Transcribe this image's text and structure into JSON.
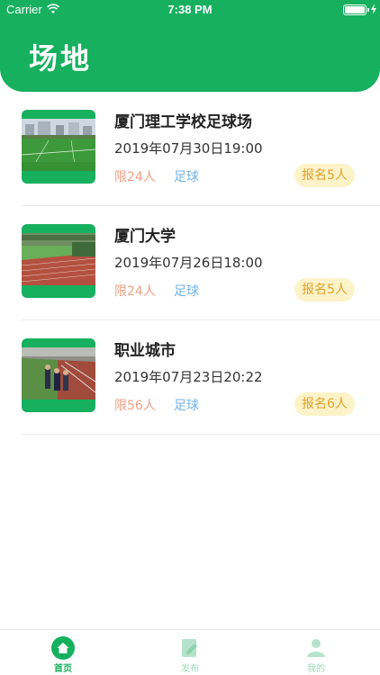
{
  "status_bar": {
    "carrier": "Carrier",
    "time": "7:38 PM"
  },
  "header": {
    "title": "场地"
  },
  "venues": [
    {
      "name": "厦门理工学校足球场",
      "datetime": "2019年07月30日19:00",
      "limit": "限24人",
      "sport": "足球",
      "signup": "报名5人"
    },
    {
      "name": "厦门大学",
      "datetime": "2019年07月26日18:00",
      "limit": "限24人",
      "sport": "足球",
      "signup": "报名5人"
    },
    {
      "name": "职业城市",
      "datetime": "2019年07月23日20:22",
      "limit": "限56人",
      "sport": "足球",
      "signup": "报名6人"
    }
  ],
  "tabs": [
    {
      "label": "首页",
      "icon": "home-icon",
      "active": true
    },
    {
      "label": "发布",
      "icon": "edit-icon",
      "active": false
    },
    {
      "label": "我的",
      "icon": "profile-icon",
      "active": false
    }
  ],
  "colors": {
    "brand": "#16b05f",
    "limit": "#ef9f85",
    "sport": "#73b3e8",
    "signup_bg": "#fdf3c9",
    "signup_text": "#e0a12d"
  }
}
